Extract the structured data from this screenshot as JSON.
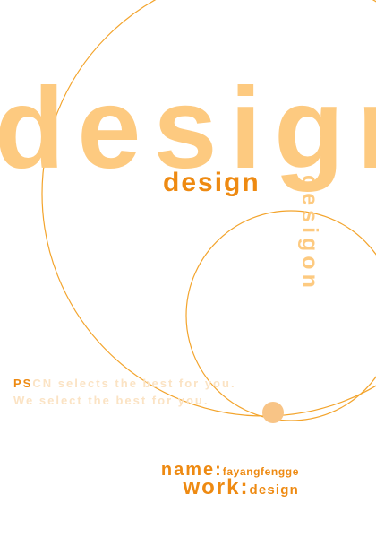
{
  "poster": {
    "headline": "design",
    "subheadline": "design",
    "vertical_word": "desigon",
    "tagline_prefix": "PS",
    "tagline_line1_rest": "CN selects the best for you.",
    "tagline_line2": "We select the best for you.",
    "name_label": "name:",
    "name_value": "fayangfengge",
    "work_label": "work:",
    "work_value": "design"
  },
  "colors": {
    "accent": "#ee8a12",
    "light_orange": "#fdca80",
    "line": "#f3a42c",
    "dot": "#f8c486",
    "tagline": "#fbe3c4",
    "background": "#ffffff"
  }
}
